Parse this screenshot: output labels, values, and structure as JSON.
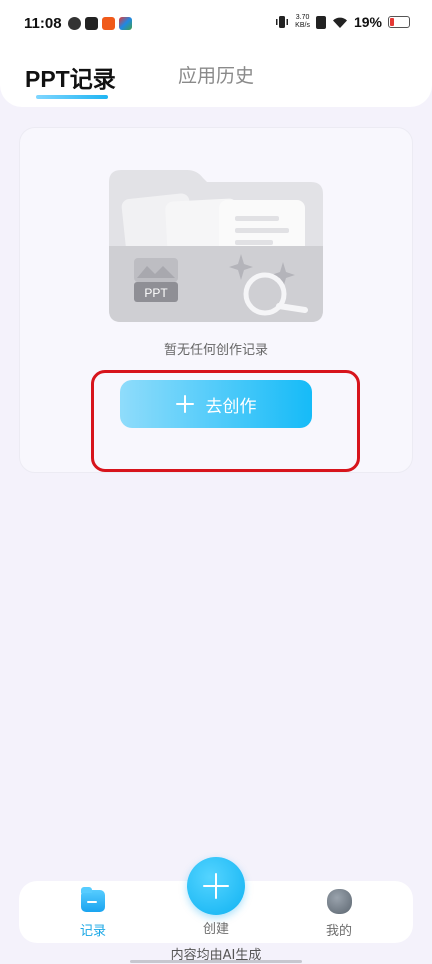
{
  "status_bar": {
    "time": "11:08",
    "net_speed_value": "3.70",
    "net_speed_unit": "KB/s",
    "battery": "19%",
    "battery_color": "#e53935"
  },
  "header": {
    "tabs": [
      {
        "label": "PPT记录",
        "active": true
      },
      {
        "label": "应用历史",
        "active": false
      }
    ]
  },
  "empty_state": {
    "illustration_label": "PPT",
    "message": "暂无任何创作记录",
    "create_button_label": "去创作"
  },
  "bottom_nav": {
    "items": [
      {
        "label": "记录",
        "icon": "folder-icon",
        "active": true
      },
      {
        "label": "创建",
        "icon": "plus-icon",
        "active": false
      },
      {
        "label": "我的",
        "icon": "avatar-icon",
        "active": false
      }
    ]
  },
  "footer": {
    "disclaimer": "内容均由AI生成"
  },
  "colors": {
    "accent": "#16bbf8",
    "annotation": "#d7141c",
    "background": "#f4f2fb"
  }
}
